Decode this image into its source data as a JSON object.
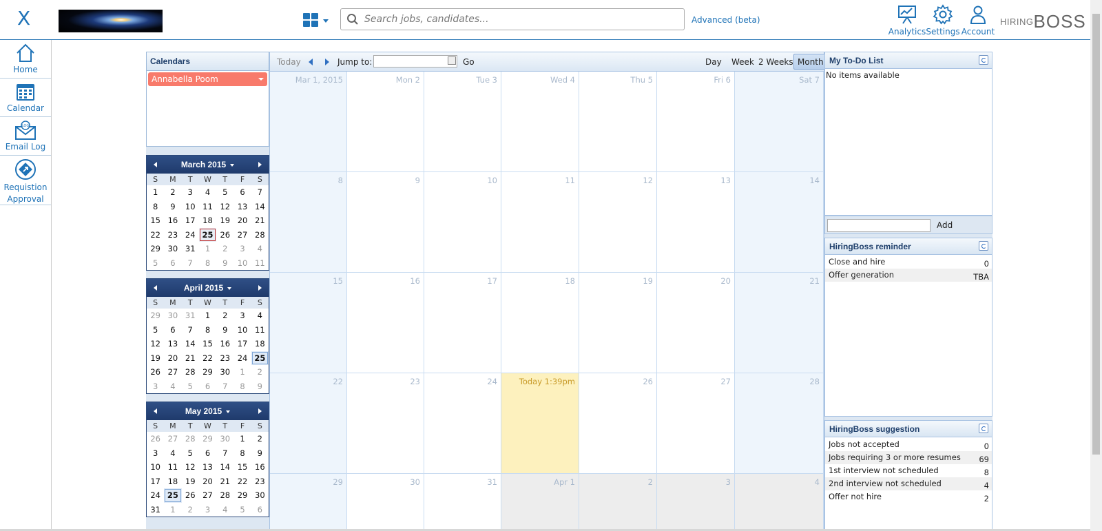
{
  "topbar": {
    "menu_glyph": "X",
    "search_placeholder": "Search jobs, candidates...",
    "advanced_label": "Advanced (beta)",
    "nav": [
      {
        "label": "Analytics"
      },
      {
        "label": "Settings"
      },
      {
        "label": "Account"
      }
    ],
    "brand_small": "HIRING",
    "brand_big": "BOSS"
  },
  "leftrail": {
    "items": [
      {
        "label": "Home"
      },
      {
        "label": "Calendar"
      },
      {
        "label": "Email Log"
      },
      {
        "label": "Requistion Approval"
      }
    ]
  },
  "calendars": {
    "title": "Calendars",
    "owner": "Annabella Poom"
  },
  "mini_calendars": [
    {
      "title": "March 2015",
      "weekdays": [
        "S",
        "M",
        "T",
        "W",
        "T",
        "F",
        "S"
      ],
      "weeks": [
        [
          [
            "1",
            0
          ],
          [
            "2",
            0
          ],
          [
            "3",
            0
          ],
          [
            "4",
            0
          ],
          [
            "5",
            0
          ],
          [
            "6",
            0
          ],
          [
            "7",
            0
          ]
        ],
        [
          [
            "8",
            0
          ],
          [
            "9",
            0
          ],
          [
            "10",
            0
          ],
          [
            "11",
            0
          ],
          [
            "12",
            0
          ],
          [
            "13",
            0
          ],
          [
            "14",
            0
          ]
        ],
        [
          [
            "15",
            0
          ],
          [
            "16",
            0
          ],
          [
            "17",
            0
          ],
          [
            "18",
            0
          ],
          [
            "19",
            0
          ],
          [
            "20",
            0
          ],
          [
            "21",
            0
          ]
        ],
        [
          [
            "22",
            0
          ],
          [
            "23",
            0
          ],
          [
            "24",
            0
          ],
          [
            "25",
            2
          ],
          [
            "26",
            0
          ],
          [
            "27",
            0
          ],
          [
            "28",
            0
          ]
        ],
        [
          [
            "29",
            0
          ],
          [
            "30",
            0
          ],
          [
            "31",
            0
          ],
          [
            "1",
            1
          ],
          [
            "2",
            1
          ],
          [
            "3",
            1
          ],
          [
            "4",
            1
          ]
        ],
        [
          [
            "5",
            1
          ],
          [
            "6",
            1
          ],
          [
            "7",
            1
          ],
          [
            "8",
            1
          ],
          [
            "9",
            1
          ],
          [
            "10",
            1
          ],
          [
            "11",
            1
          ]
        ]
      ]
    },
    {
      "title": "April 2015",
      "weekdays": [
        "S",
        "M",
        "T",
        "W",
        "T",
        "F",
        "S"
      ],
      "weeks": [
        [
          [
            "29",
            1
          ],
          [
            "30",
            1
          ],
          [
            "31",
            1
          ],
          [
            "1",
            0
          ],
          [
            "2",
            0
          ],
          [
            "3",
            0
          ],
          [
            "4",
            0
          ]
        ],
        [
          [
            "5",
            0
          ],
          [
            "6",
            0
          ],
          [
            "7",
            0
          ],
          [
            "8",
            0
          ],
          [
            "9",
            0
          ],
          [
            "10",
            0
          ],
          [
            "11",
            0
          ]
        ],
        [
          [
            "12",
            0
          ],
          [
            "13",
            0
          ],
          [
            "14",
            0
          ],
          [
            "15",
            0
          ],
          [
            "16",
            0
          ],
          [
            "17",
            0
          ],
          [
            "18",
            0
          ]
        ],
        [
          [
            "19",
            0
          ],
          [
            "20",
            0
          ],
          [
            "21",
            0
          ],
          [
            "22",
            0
          ],
          [
            "23",
            0
          ],
          [
            "24",
            0
          ],
          [
            "25",
            3
          ]
        ],
        [
          [
            "26",
            0
          ],
          [
            "27",
            0
          ],
          [
            "28",
            0
          ],
          [
            "29",
            0
          ],
          [
            "30",
            0
          ],
          [
            "1",
            1
          ],
          [
            "2",
            1
          ]
        ],
        [
          [
            "3",
            1
          ],
          [
            "4",
            1
          ],
          [
            "5",
            1
          ],
          [
            "6",
            1
          ],
          [
            "7",
            1
          ],
          [
            "8",
            1
          ],
          [
            "9",
            1
          ]
        ]
      ]
    },
    {
      "title": "May 2015",
      "weekdays": [
        "S",
        "M",
        "T",
        "W",
        "T",
        "F",
        "S"
      ],
      "weeks": [
        [
          [
            "26",
            1
          ],
          [
            "27",
            1
          ],
          [
            "28",
            1
          ],
          [
            "29",
            1
          ],
          [
            "30",
            1
          ],
          [
            "1",
            0
          ],
          [
            "2",
            0
          ]
        ],
        [
          [
            "3",
            0
          ],
          [
            "4",
            0
          ],
          [
            "5",
            0
          ],
          [
            "6",
            0
          ],
          [
            "7",
            0
          ],
          [
            "8",
            0
          ],
          [
            "9",
            0
          ]
        ],
        [
          [
            "10",
            0
          ],
          [
            "11",
            0
          ],
          [
            "12",
            0
          ],
          [
            "13",
            0
          ],
          [
            "14",
            0
          ],
          [
            "15",
            0
          ],
          [
            "16",
            0
          ]
        ],
        [
          [
            "17",
            0
          ],
          [
            "18",
            0
          ],
          [
            "19",
            0
          ],
          [
            "20",
            0
          ],
          [
            "21",
            0
          ],
          [
            "22",
            0
          ],
          [
            "23",
            0
          ]
        ],
        [
          [
            "24",
            0
          ],
          [
            "25",
            3
          ],
          [
            "26",
            0
          ],
          [
            "27",
            0
          ],
          [
            "28",
            0
          ],
          [
            "29",
            0
          ],
          [
            "30",
            0
          ]
        ],
        [
          [
            "31",
            0
          ],
          [
            "1",
            1
          ],
          [
            "2",
            1
          ],
          [
            "3",
            1
          ],
          [
            "4",
            1
          ],
          [
            "5",
            1
          ],
          [
            "6",
            1
          ]
        ]
      ]
    }
  ],
  "toolbar": {
    "today": "Today",
    "jump_to": "Jump to:",
    "go": "Go",
    "views": [
      "Day",
      "Week",
      "2 Weeks",
      "Month"
    ],
    "active_view": "Month"
  },
  "month": {
    "rows": [
      [
        [
          "Mar 1, 2015",
          "wk"
        ],
        [
          "Mon 2",
          ""
        ],
        [
          "Tue 3",
          ""
        ],
        [
          "Wed 4",
          ""
        ],
        [
          "Thu 5",
          ""
        ],
        [
          "Fri 6",
          ""
        ],
        [
          "Sat 7",
          "wk"
        ]
      ],
      [
        [
          "8",
          "wk"
        ],
        [
          "9",
          ""
        ],
        [
          "10",
          ""
        ],
        [
          "11",
          ""
        ],
        [
          "12",
          ""
        ],
        [
          "13",
          ""
        ],
        [
          "14",
          "wk"
        ]
      ],
      [
        [
          "15",
          "wk"
        ],
        [
          "16",
          ""
        ],
        [
          "17",
          ""
        ],
        [
          "18",
          ""
        ],
        [
          "19",
          ""
        ],
        [
          "20",
          ""
        ],
        [
          "21",
          "wk"
        ]
      ],
      [
        [
          "22",
          "wk"
        ],
        [
          "23",
          ""
        ],
        [
          "24",
          ""
        ],
        [
          "Today 1:39pm",
          "today"
        ],
        [
          "26",
          ""
        ],
        [
          "27",
          ""
        ],
        [
          "28",
          "wk"
        ]
      ],
      [
        [
          "29",
          "wk"
        ],
        [
          "30",
          ""
        ],
        [
          "31",
          ""
        ],
        [
          "Apr 1",
          "other"
        ],
        [
          "2",
          "other"
        ],
        [
          "3",
          "other"
        ],
        [
          "4",
          "other"
        ]
      ]
    ]
  },
  "todo": {
    "title": "My To-Do List",
    "empty_text": "No items available",
    "add_label": "Add"
  },
  "reminder": {
    "title": "HiringBoss reminder",
    "rows": [
      {
        "label": "Close and hire",
        "value": "0"
      },
      {
        "label": "Offer generation",
        "value": "TBA"
      }
    ]
  },
  "suggestion": {
    "title": "HiringBoss suggestion",
    "rows": [
      {
        "label": "Jobs not accepted",
        "value": "0"
      },
      {
        "label": "Jobs requiring 3 or more resumes",
        "value": "69"
      },
      {
        "label": "1st interview not scheduled",
        "value": "8"
      },
      {
        "label": "2nd interview not scheduled",
        "value": "4"
      },
      {
        "label": "Offer not hire",
        "value": "2"
      }
    ]
  },
  "colors": {
    "accent": "#1f73b7",
    "owner_badge": "#f87a6b",
    "today_cell": "#fdf1be",
    "mini_header": "#243f72"
  }
}
